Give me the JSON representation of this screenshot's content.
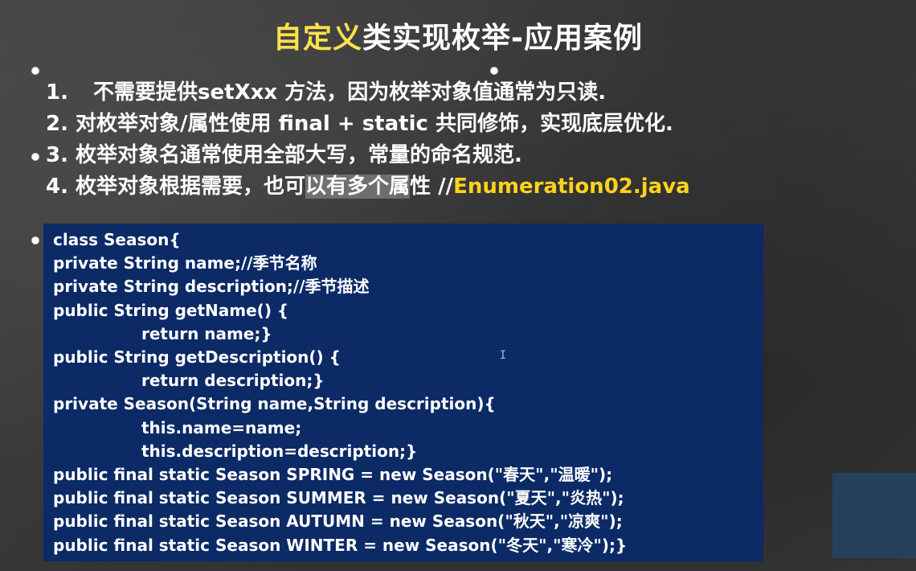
{
  "title": {
    "highlight": "自定义",
    "rest": "类实现枚举-应用案例"
  },
  "points": [
    {
      "num": "1.",
      "text": "不需要提供setXxx 方法，因为枚举对象值通常为只读."
    },
    {
      "num": "2.",
      "text": "对枚举对象/属性使用 final + static 共同修饰，实现底层优化."
    },
    {
      "num": "3.",
      "text": "枚举对象名通常使用全部大写，常量的命名规范."
    },
    {
      "num": "4.",
      "text_a": "枚举对象根据需要，也可",
      "text_shaded": "以有多个属",
      "text_b": "性 //",
      "file": "Enumeration02.java"
    }
  ],
  "code": [
    "class Season{",
    "private String name;//季节名称",
    "private String description;//季节描述",
    "public String getName() {",
    "return name;}",
    "public String getDescription() {",
    "return description;}",
    "private Season(String name,String description){",
    "this.name=name;",
    "this.description=description;}",
    "public final static Season SPRING = new Season(\"春天\",\"温暖\");",
    "public final static Season SUMMER = new Season(\"夏天\",\"炎热\");",
    "public final static Season AUTUMN = new Season(\"秋天\",\"凉爽\");",
    "public final static Season WINTER = new Season(\"冬天\",\"寒冷\");}"
  ],
  "cursor_icon": "text-cursor-icon"
}
